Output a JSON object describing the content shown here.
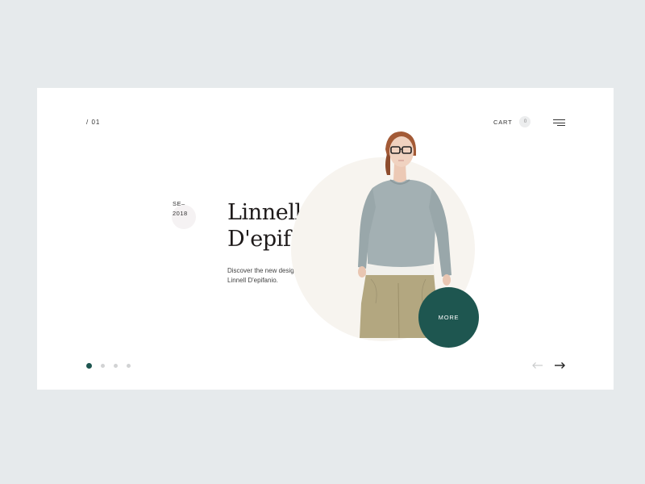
{
  "header": {
    "slide_index": "/  01",
    "cart_label": "CART",
    "cart_count": "0"
  },
  "hero": {
    "season_line1": "SE–",
    "season_line2": "2018",
    "title_line1": "Linnell",
    "title_line2": "D'epifanio",
    "description": "Discover the new designer collections of Linnell D'epifanio.",
    "more_label": "MORE"
  },
  "pagination": {
    "count": 4,
    "active": 0
  },
  "icons": {
    "menu": "hamburger-menu-icon",
    "prev": "arrow-left-icon",
    "next": "arrow-right-icon"
  },
  "colors": {
    "accent": "#1e5650",
    "background": "#e6eaec",
    "card": "#ffffff",
    "circle": "#f7f4ef"
  }
}
